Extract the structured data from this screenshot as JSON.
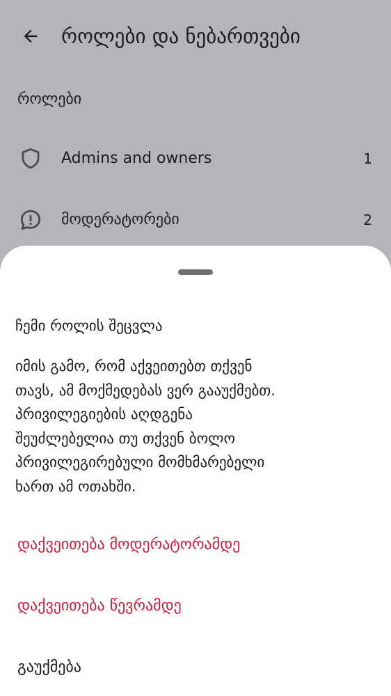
{
  "header": {
    "title": "როლები და ნებართვები"
  },
  "roles_section": {
    "title": "როლები",
    "items": [
      {
        "label": "Admins and owners",
        "count": "1",
        "icon": "shield-icon"
      },
      {
        "label": "მოდერატორები",
        "count": "2",
        "icon": "chat-alert-icon"
      }
    ]
  },
  "sheet": {
    "title": "ჩემი როლის შეცვლა",
    "message_lines": [
      "იმის გამო, რომ აქვეითებთ თქვენ",
      "თავს, ამ მოქმედებას ვერ გააუქმებთ.",
      "პრივილეგიების აღდგენა",
      "შეუძლებელია თუ თქვენ ბოლო",
      "პრივილეგირებული მომხმარებელი",
      "ხართ ამ ოთახში."
    ],
    "actions": {
      "demote_to_moderator": "დაქვეითება მოდერატორამდე",
      "demote_to_member": "დაქვეითება წევრამდე",
      "cancel": "გაუქმება"
    }
  },
  "colors": {
    "danger": "#d71b37",
    "scrim_background": "#b4b5b9",
    "sheet_background": "#ffffff"
  }
}
